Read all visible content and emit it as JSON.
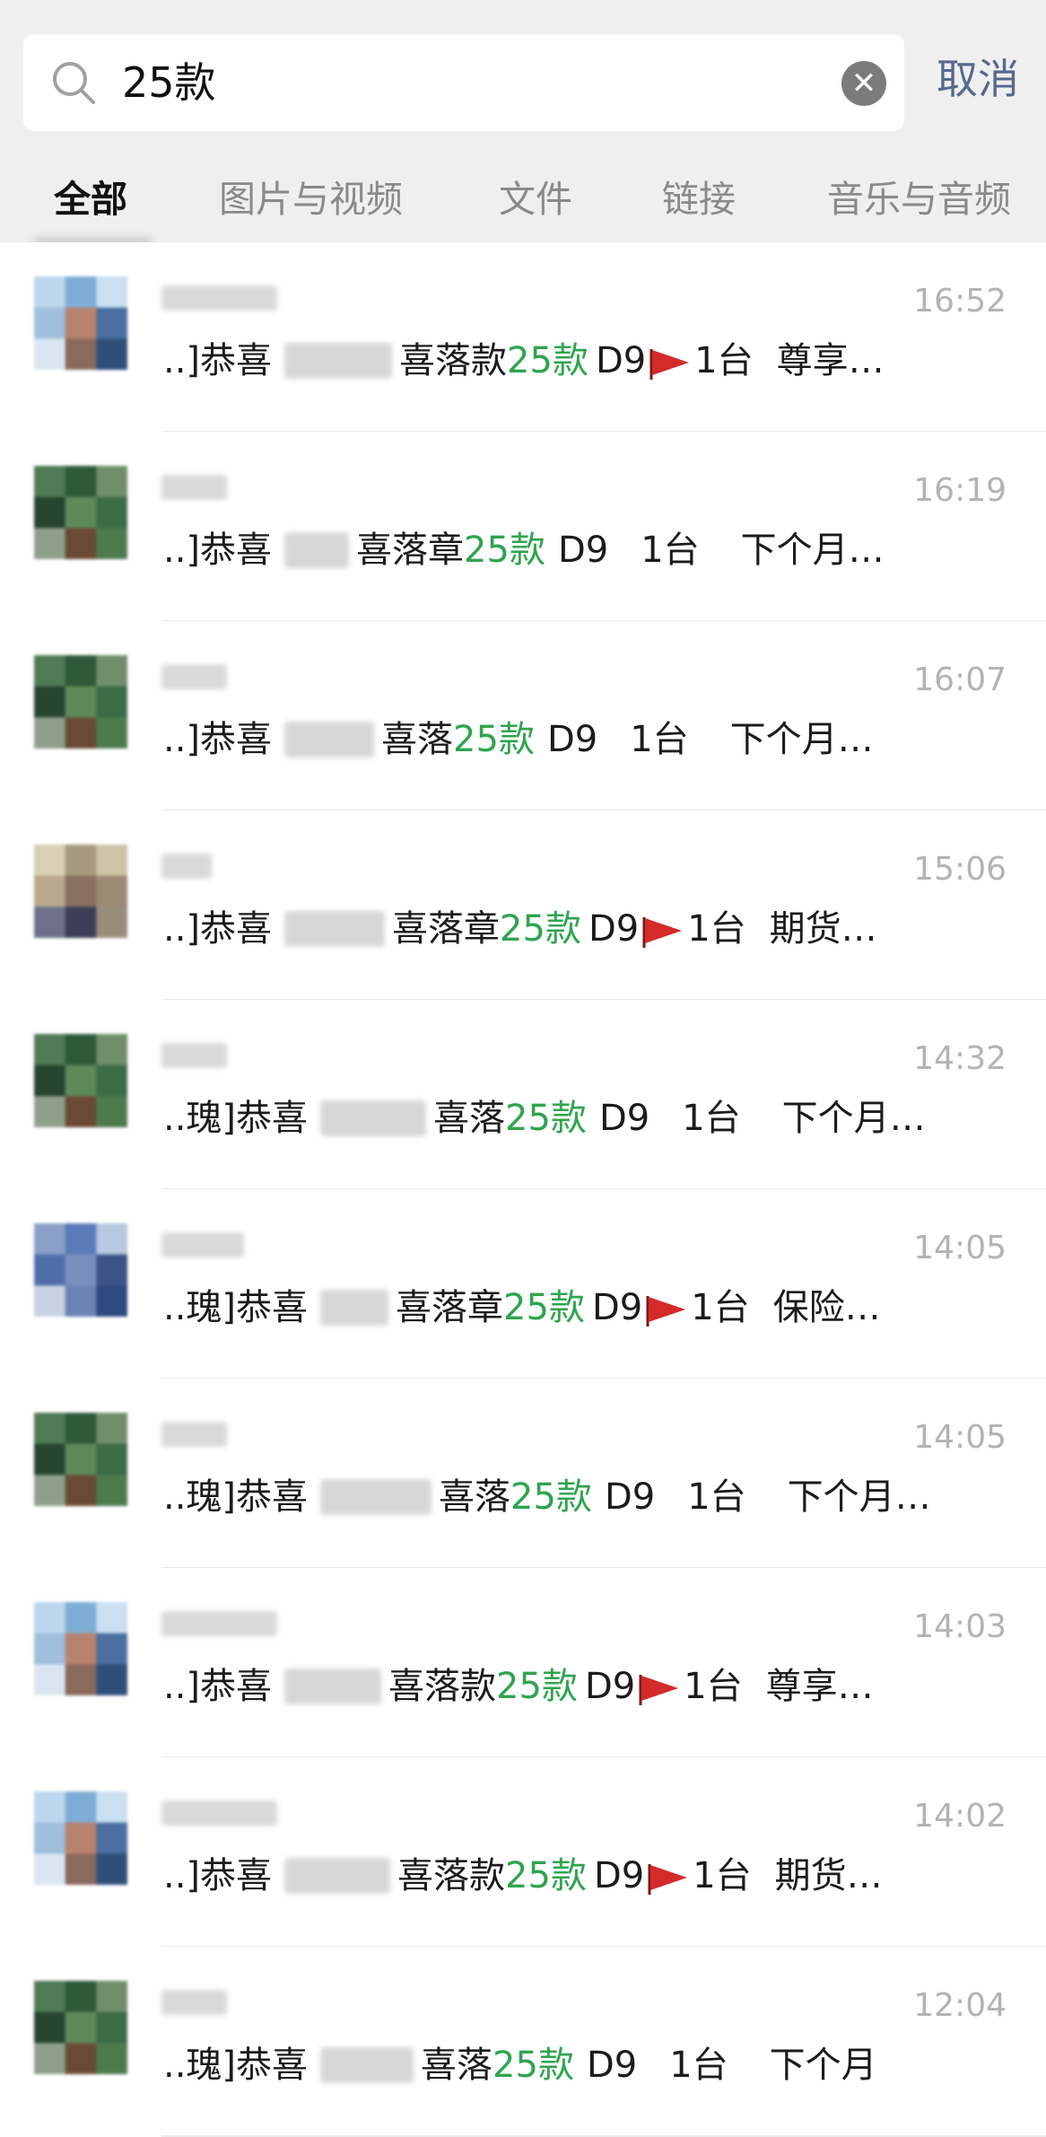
{
  "search": {
    "query": "25款",
    "cancel_label": "取消"
  },
  "tabs": [
    {
      "label": "全部",
      "active": true
    },
    {
      "label": "图片与视频",
      "active": false
    },
    {
      "label": "文件",
      "active": false
    },
    {
      "label": "链接",
      "active": false
    },
    {
      "label": "音乐与音频",
      "active": false
    }
  ],
  "colors": {
    "keyword": "#2fa44f",
    "cancel": "#56688f",
    "flag": "#d42a2a"
  },
  "results": [
    {
      "time": "16:52",
      "prefix": "..]恭喜",
      "after": "喜落款",
      "keyword": "25款",
      "model": "D9",
      "flag": true,
      "count": "1台",
      "tail": "尊享…",
      "avatar": "blue"
    },
    {
      "time": "16:19",
      "prefix": "..]恭喜",
      "after": "喜落章",
      "keyword": "25款",
      "model": "D9",
      "flag": false,
      "count": "1台",
      "tail": "下个月…",
      "avatar": "green"
    },
    {
      "time": "16:07",
      "prefix": "..]恭喜",
      "after": "喜落",
      "keyword": "25款",
      "model": "D9",
      "flag": false,
      "count": "1台",
      "tail": "下个月…",
      "avatar": "green"
    },
    {
      "time": "15:06",
      "prefix": "..]恭喜",
      "after": "喜落章",
      "keyword": "25款",
      "model": "D9",
      "flag": true,
      "count": "1台",
      "tail": "期货…",
      "avatar": "tan"
    },
    {
      "time": "14:32",
      "prefix": "..瑰]恭喜",
      "after": "喜落",
      "keyword": "25款",
      "model": "D9",
      "flag": false,
      "count": "1台",
      "tail": "下个月…",
      "avatar": "green"
    },
    {
      "time": "14:05",
      "prefix": "..瑰]恭喜",
      "after": "喜落章",
      "keyword": "25款",
      "model": "D9",
      "flag": true,
      "count": "1台",
      "tail": "保险…",
      "avatar": "navy"
    },
    {
      "time": "14:05",
      "prefix": "..瑰]恭喜",
      "after": "喜落",
      "keyword": "25款",
      "model": "D9",
      "flag": false,
      "count": "1台",
      "tail": "下个月…",
      "avatar": "green"
    },
    {
      "time": "14:03",
      "prefix": "..]恭喜",
      "after": "喜落款",
      "keyword": "25款",
      "model": "D9",
      "flag": true,
      "count": "1台",
      "tail": "尊享…",
      "avatar": "blue"
    },
    {
      "time": "14:02",
      "prefix": "..]恭喜",
      "after": "喜落款",
      "keyword": "25款",
      "model": "D9",
      "flag": true,
      "count": "1台",
      "tail": "期货…",
      "avatar": "blue"
    },
    {
      "time": "12:04",
      "prefix": "..瑰]恭喜",
      "after": "喜落",
      "keyword": "25款",
      "model": "D9",
      "flag": false,
      "count": "1台",
      "tail": "下个月",
      "avatar": "green"
    }
  ]
}
